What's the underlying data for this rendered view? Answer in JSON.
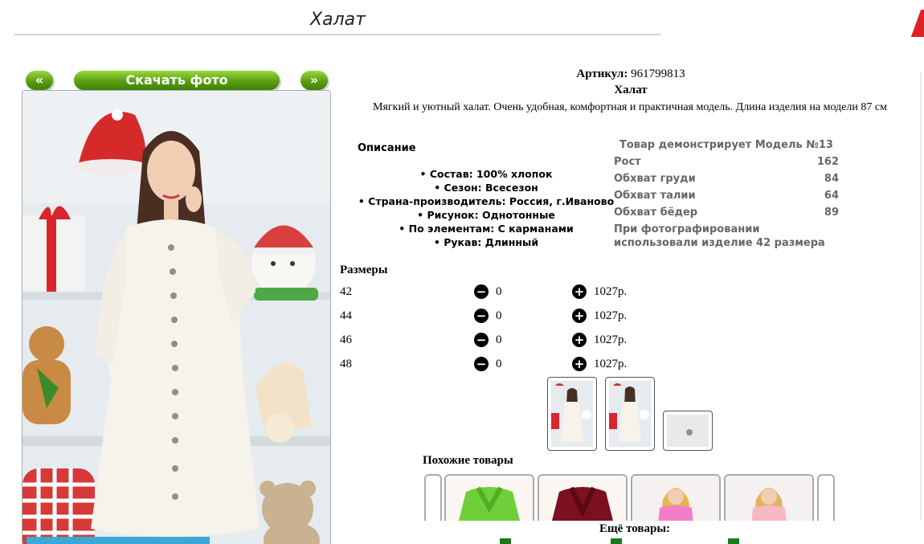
{
  "header": {
    "title": "Халат"
  },
  "gallery": {
    "prev_label": "«",
    "download_label": "Скачать фото",
    "next_label": "»"
  },
  "product": {
    "article_label": "Артикул:",
    "article_value": "961799813",
    "name": "Халат",
    "description": "Мягкий и уютный халат. Очень удобная, комфортная и практичная модель. Длина изделия на модели 87 см"
  },
  "specs": {
    "heading": "Описание",
    "items": [
      "Состав: 100% хлопок",
      "Сезон: Всесезон",
      "Страна-производитель: Россия, г.Иваново",
      "Рисунок: Однотонные",
      "По элементам: С карманами",
      "Рукав: Длинный"
    ]
  },
  "model": {
    "title": "Товар демонстрирует Модель №13",
    "rows": [
      {
        "label": "Рост",
        "value": "162"
      },
      {
        "label": "Обхват груди",
        "value": "84"
      },
      {
        "label": "Обхват талии",
        "value": "64"
      },
      {
        "label": "Обхват бёдер",
        "value": "89"
      }
    ],
    "note": "При фотографировании использовали изделие 42 размера"
  },
  "sizes": {
    "heading": "Размеры",
    "rows": [
      {
        "size": "42",
        "qty": "0",
        "price": "1027р."
      },
      {
        "size": "44",
        "qty": "0",
        "price": "1027р."
      },
      {
        "size": "46",
        "qty": "0",
        "price": "1027р."
      },
      {
        "size": "48",
        "qty": "0",
        "price": "1027р."
      }
    ]
  },
  "similar": {
    "heading": "Похожие товары"
  },
  "more": {
    "heading": "Ещё товары:"
  },
  "colors": {
    "button_green": "#5a9e12",
    "robe_white": "#f6f3ea",
    "similar_green": "#6fcf3a",
    "similar_burgundy": "#7a1020",
    "similar_pink": "#f07fc8",
    "similar_light_pink": "#f7b8c6",
    "link_green": "#1a7a1a"
  }
}
